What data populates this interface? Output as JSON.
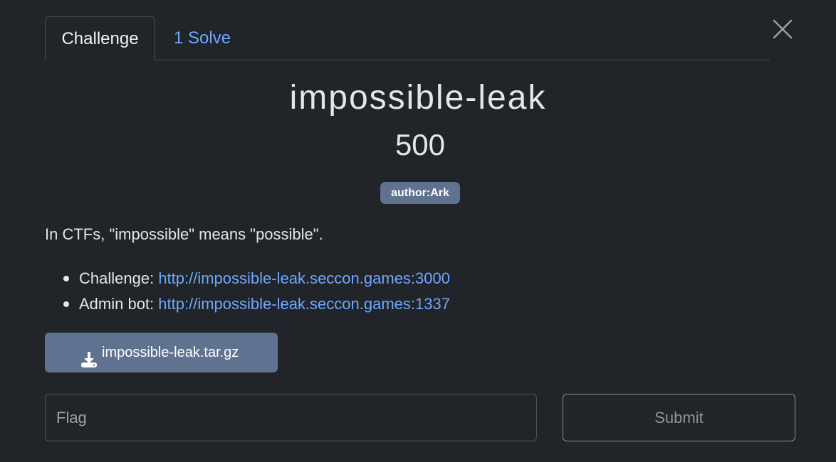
{
  "tabs": [
    {
      "label": "Challenge"
    },
    {
      "label": "1 Solve"
    }
  ],
  "close": {
    "icon": "close-icon"
  },
  "challenge": {
    "name": "impossible-leak",
    "points": "500",
    "tag": "author:Ark",
    "description": "In CTFs, \"impossible\" means \"possible\".",
    "links": [
      {
        "label": "Challenge: ",
        "url": "http://impossible-leak.seccon.games:3000"
      },
      {
        "label": "Admin bot: ",
        "url": "http://impossible-leak.seccon.games:1337"
      }
    ],
    "file": {
      "name": "impossible-leak.tar.gz",
      "icon": "download-icon"
    }
  },
  "form": {
    "flag_placeholder": "Flag",
    "submit_label": "Submit"
  },
  "colors": {
    "background": "#212429",
    "link": "#6ea8fe",
    "badge": "#5f7290"
  }
}
